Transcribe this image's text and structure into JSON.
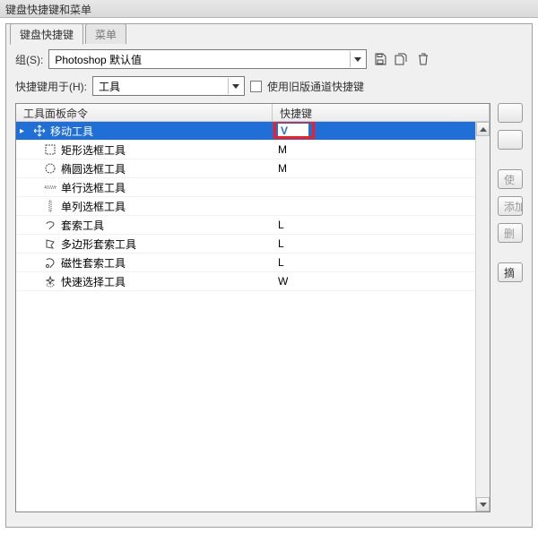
{
  "window": {
    "title": "键盘快捷键和菜单"
  },
  "tabs": [
    {
      "label": "键盘快捷键",
      "active": true
    },
    {
      "label": "菜单",
      "active": false
    }
  ],
  "group": {
    "label": "组(S):",
    "value": "Photoshop 默认值"
  },
  "shortcutsFor": {
    "label": "快捷键用于(H):",
    "value": "工具"
  },
  "legacyCheckbox": {
    "label": "使用旧版通道快捷键",
    "checked": false
  },
  "icons": {
    "save": "save-icon",
    "saveCopy": "save-copy-icon",
    "trash": "trash-icon"
  },
  "table": {
    "headers": {
      "command": "工具面板命令",
      "shortcut": "快捷键"
    },
    "rows": [
      {
        "icon": "move-icon",
        "label": "移动工具",
        "shortcut": "V",
        "selected": true,
        "editing": true,
        "sub": false
      },
      {
        "icon": "rect-marquee-icon",
        "label": "矩形选框工具",
        "shortcut": "M",
        "selected": false,
        "sub": true
      },
      {
        "icon": "ellipse-marquee-icon",
        "label": "椭圆选框工具",
        "shortcut": "M",
        "selected": false,
        "sub": true
      },
      {
        "icon": "row-marquee-icon",
        "label": "单行选框工具",
        "shortcut": "",
        "selected": false,
        "sub": true
      },
      {
        "icon": "col-marquee-icon",
        "label": "单列选框工具",
        "shortcut": "",
        "selected": false,
        "sub": true
      },
      {
        "icon": "lasso-icon",
        "label": "套索工具",
        "shortcut": "L",
        "selected": false,
        "sub": true
      },
      {
        "icon": "poly-lasso-icon",
        "label": "多边形套索工具",
        "shortcut": "L",
        "selected": false,
        "sub": true
      },
      {
        "icon": "mag-lasso-icon",
        "label": "磁性套索工具",
        "shortcut": "L",
        "selected": false,
        "sub": true
      },
      {
        "icon": "quick-select-icon",
        "label": "快速选择工具",
        "shortcut": "W",
        "selected": false,
        "sub": true
      }
    ]
  },
  "sideButtons": [
    {
      "label": "",
      "disabled": false
    },
    {
      "label": "",
      "disabled": false
    },
    {
      "label": "使",
      "disabled": true
    },
    {
      "label": "添加",
      "disabled": true
    },
    {
      "label": "删",
      "disabled": true
    },
    {
      "label": "摘",
      "disabled": false
    }
  ]
}
